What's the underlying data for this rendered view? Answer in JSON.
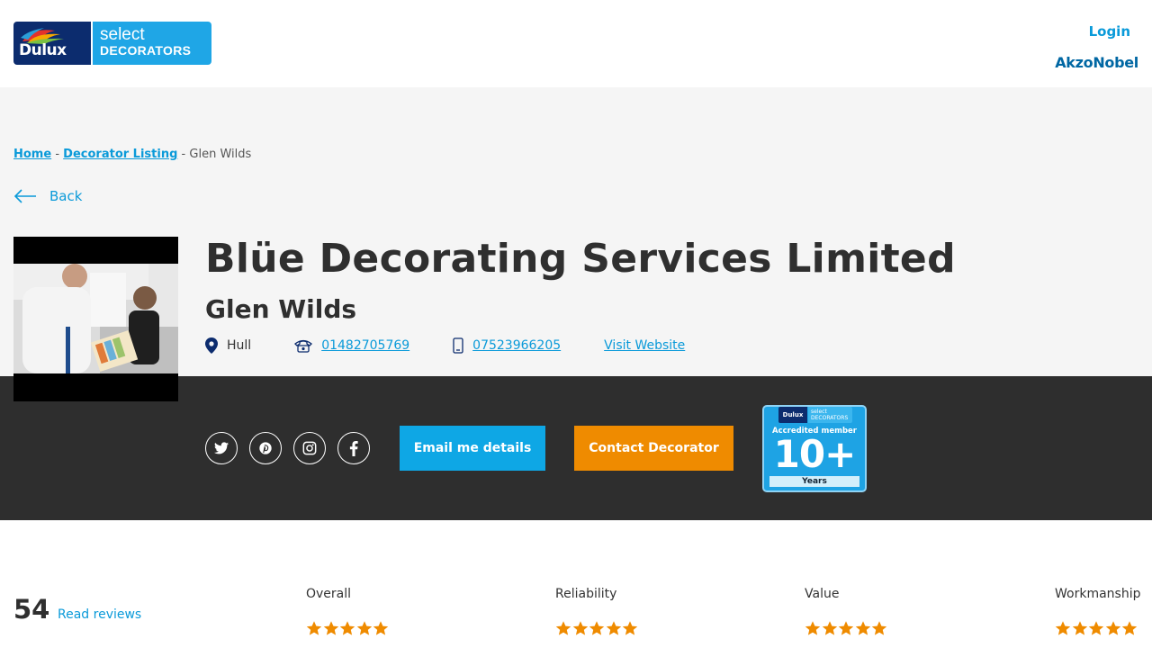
{
  "header": {
    "logo_primary": "Dulux",
    "logo_select": "select",
    "logo_decorators": "DECORATORS",
    "login_label": "Login",
    "partner_brand": "AkzoNobel"
  },
  "breadcrumb": {
    "home": "Home",
    "separator": "-",
    "listing": "Decorator Listing",
    "current": "Glen Wilds"
  },
  "back_label": "Back",
  "profile": {
    "company_name": "Blüe Decorating Services Limited",
    "person_name": "Glen Wilds",
    "location": "Hull",
    "phone": "01482705769",
    "mobile": "07523966205",
    "website_label": "Visit Website"
  },
  "socials": [
    "twitter-icon",
    "pinterest-icon",
    "instagram-icon",
    "facebook-icon"
  ],
  "actions": {
    "email_label": "Email me details",
    "contact_label": "Contact Decorator"
  },
  "badge": {
    "brand": "Dulux",
    "select": "select",
    "decorators": "DECORATORS",
    "accredited": "Accredited member",
    "years_value": "10+",
    "years_label": "Years"
  },
  "reviews": {
    "count": "54",
    "read_label": "Read reviews",
    "ratings": [
      {
        "label": "Overall",
        "stars": 5
      },
      {
        "label": "Reliability",
        "stars": 5
      },
      {
        "label": "Value",
        "stars": 5
      },
      {
        "label": "Workmanship",
        "stars": 5
      }
    ]
  },
  "colors": {
    "accent_blue": "#0a9ad9",
    "dark_band": "#2e2e2e",
    "email_button": "#0ea7e5",
    "contact_button": "#ef8b00",
    "star": "#ef8b00"
  }
}
